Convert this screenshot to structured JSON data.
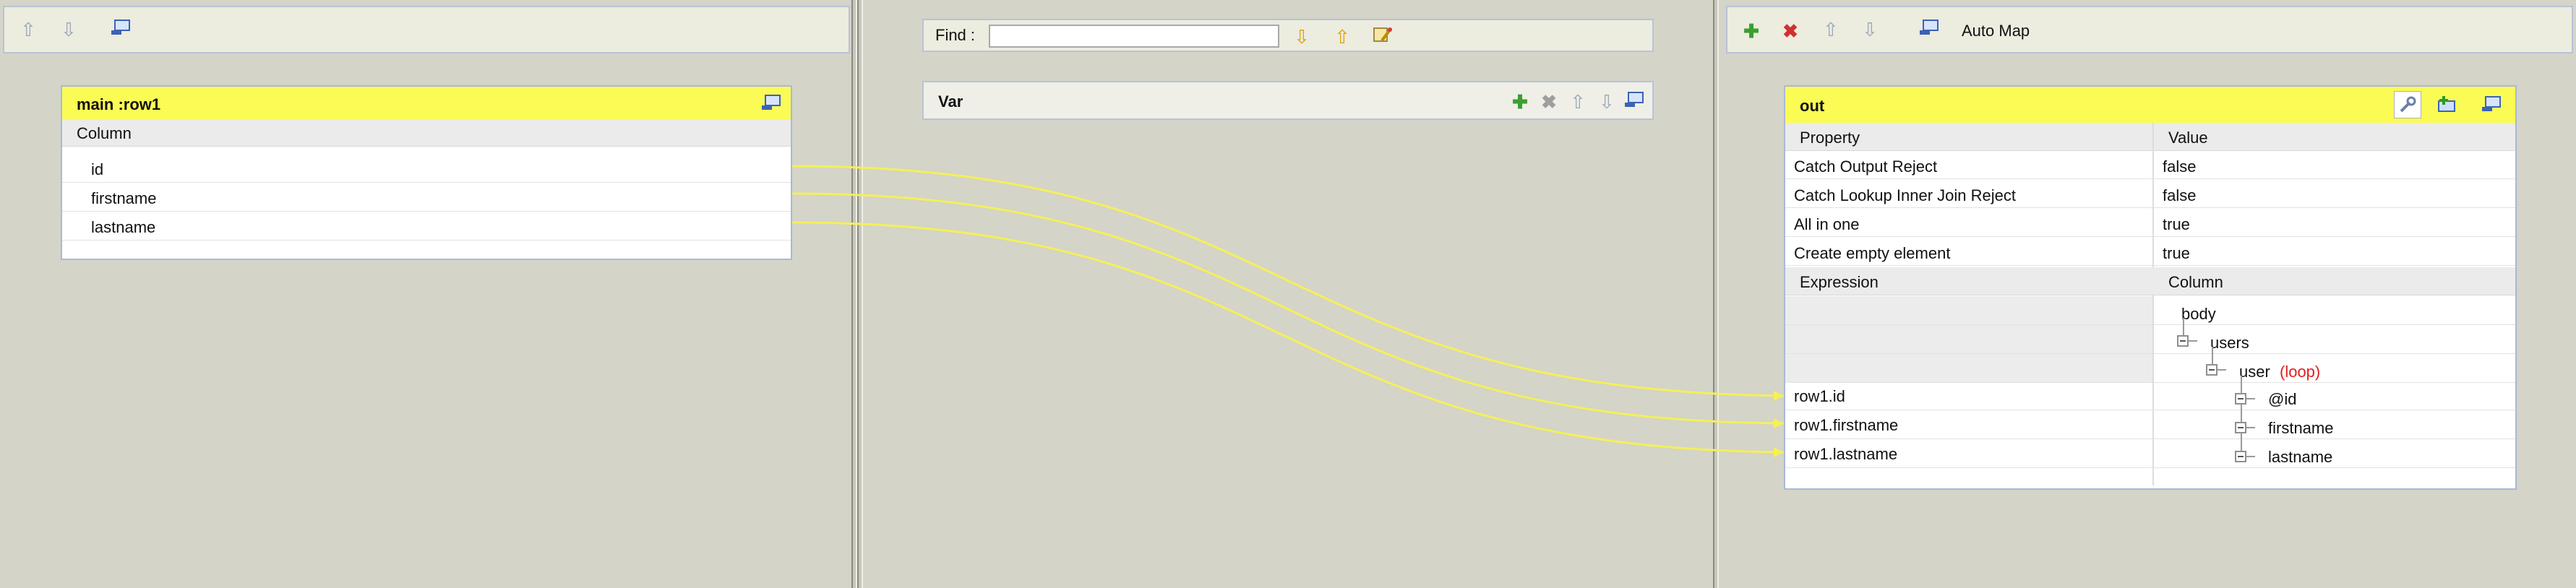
{
  "left_panel": {
    "table": {
      "title": "main :row1",
      "column_header": "Column",
      "rows": [
        "id",
        "firstname",
        "lastname"
      ]
    }
  },
  "center_panel": {
    "find_label": "Find :",
    "find_value": "",
    "var_title": "Var"
  },
  "right_panel": {
    "toolbar": {
      "auto_map_label": "Auto Map"
    },
    "table": {
      "title": "out",
      "property_header": "Property",
      "value_header": "Value",
      "properties": [
        {
          "name": "Catch Output Reject",
          "value": "false"
        },
        {
          "name": "Catch Lookup Inner Join Reject",
          "value": "false"
        },
        {
          "name": "All in one",
          "value": "true"
        },
        {
          "name": "Create empty element",
          "value": "true"
        }
      ],
      "expression_header": "Expression",
      "column_header": "Column",
      "expressions": [
        "row1.id",
        "row1.firstname",
        "row1.lastname"
      ],
      "tree": {
        "body": "body",
        "users": "users",
        "user": "user",
        "loop_tag": "(loop)",
        "attr_id": "@id",
        "firstname": "firstname",
        "lastname": "lastname"
      }
    }
  },
  "colors": {
    "header_yellow": "#fbfb55",
    "link_yellow": "#f4f05a",
    "loop_red": "#e02020",
    "panel_bg": "#d4d4c8"
  }
}
